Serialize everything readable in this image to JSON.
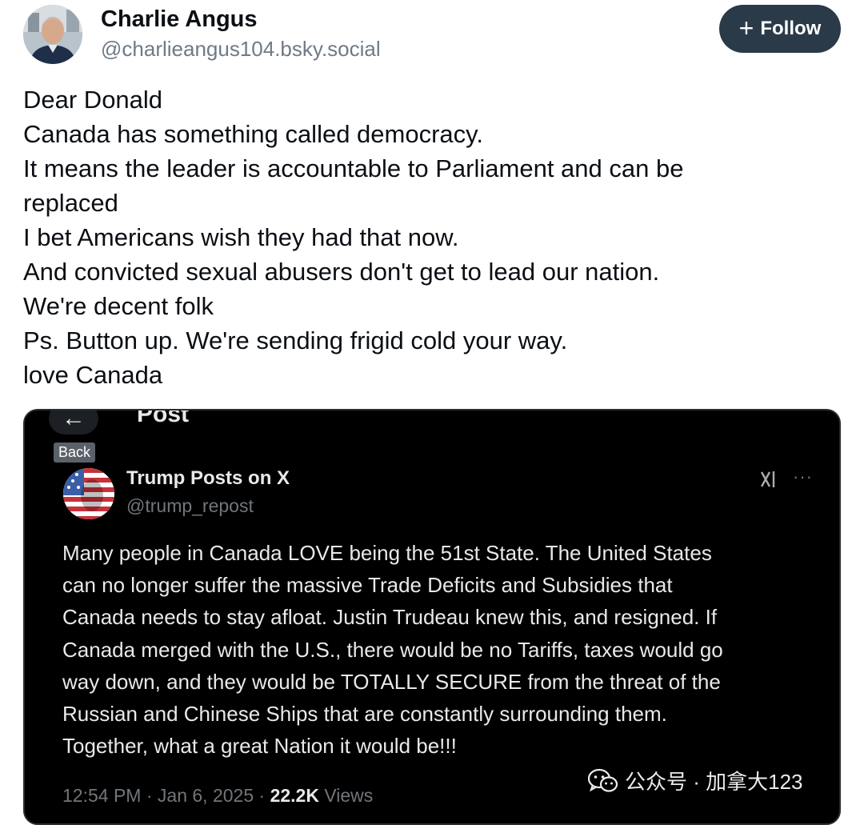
{
  "author": {
    "name": "Charlie Angus",
    "handle": "@charlieangus104.bsky.social",
    "avatar_icon": "profile-photo"
  },
  "follow_button": {
    "icon": "plus-icon",
    "plus_glyph": "+",
    "label": "Follow"
  },
  "post_lines": [
    "Dear Donald",
    "Canada has something called democracy.",
    "It means the leader is accountable to Parliament and can be",
    "replaced",
    "I bet Americans wish they had that now.",
    "And convicted sexual abusers don't get to lead our nation.",
    "We're decent folk",
    "Ps. Button up. We're sending frigid cold your way.",
    "love Canada"
  ],
  "embed": {
    "header_title": "Post",
    "back_arrow_glyph": "←",
    "back_tooltip": "Back",
    "author_name": "Trump Posts on X",
    "author_handle": "@trump_repost",
    "grok_icon": "grok-icon",
    "more_glyph": "···",
    "text_lines": [
      "Many people in Canada LOVE being the 51st State. The United States",
      "can no longer suffer the massive Trade Deficits and Subsidies that",
      "Canada needs to stay afloat. Justin Trudeau knew this, and resigned. If",
      "Canada merged with the U.S., there would be no Tariffs, taxes would go",
      "way down, and they would be TOTALLY SECURE from the threat of the",
      "Russian and Chinese Ships that are constantly surrounding them.",
      "Together, what a great Nation it would be!!!"
    ],
    "time": "12:54 PM",
    "separator": "·",
    "date": "Jan 6, 2025",
    "views_count": "22.2K",
    "views_label": "Views"
  },
  "watermark": {
    "icon": "wechat-icon",
    "text": "公众号 · 加拿大123"
  },
  "colors": {
    "follow_bg": "#2b3a49",
    "handle_gray": "#6f7a86",
    "embed_bg": "#000000",
    "embed_text": "#e7e9ea",
    "embed_muted": "#71767b"
  }
}
